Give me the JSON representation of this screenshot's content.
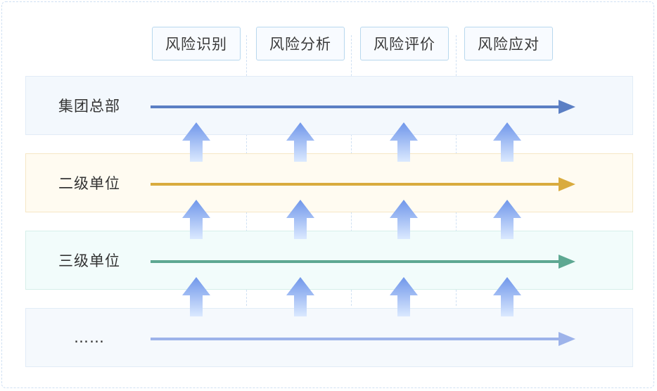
{
  "stages": [
    "风险识别",
    "风险分析",
    "风险评价",
    "风险应对"
  ],
  "levels": [
    {
      "label": "集团总部",
      "line_color": "#5b7fc4",
      "band_color": "#f3f8fd",
      "border_color": "#e1ecf7"
    },
    {
      "label": "二级单位",
      "line_color": "#d9ab3e",
      "band_color": "#fffbf1",
      "border_color": "#f6e7c5"
    },
    {
      "label": "三级单位",
      "line_color": "#5ea892",
      "band_color": "#f2fcfb",
      "border_color": "#d6efea"
    },
    {
      "label": "……",
      "line_color": "#9db3ea",
      "band_color": "#f5f9fd",
      "border_color": "#e1ecf7"
    }
  ],
  "arrow_colors": {
    "top": "#6f96ea",
    "bottom": "#dbe9ff"
  }
}
